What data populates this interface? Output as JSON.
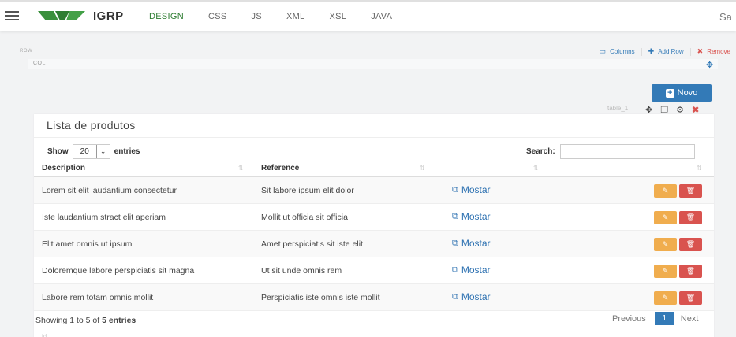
{
  "header": {
    "brand": "IGRP",
    "tabs": [
      "DESIGN",
      "CSS",
      "JS",
      "XML",
      "XSL",
      "JAVA"
    ],
    "active_tab": "DESIGN",
    "save_label": "Sa"
  },
  "rowbar": {
    "row_label": "ROW",
    "col_label": "COL",
    "columns_label": "Columns",
    "add_row_label": "Add Row",
    "remove_label": "Remove"
  },
  "toolbar": {
    "novo_label": "Novo",
    "table_tag": "table_1"
  },
  "panel": {
    "title": "Lista de produtos",
    "show_label": "Show",
    "entries_value": "20",
    "entries_label": "entries",
    "search_label": "Search:",
    "search_value": "",
    "columns": [
      "Description",
      "Reference",
      "",
      ""
    ],
    "rows": [
      {
        "description": "Lorem sit elit laudantium consectetur",
        "reference": "Sit labore ipsum elit dolor",
        "link": "Mostar"
      },
      {
        "description": "Iste laudantium stract elit aperiam",
        "reference": "Mollit ut officia sit officia",
        "link": "Mostar"
      },
      {
        "description": "Elit amet omnis ut ipsum",
        "reference": "Amet perspiciatis sit iste elit",
        "link": "Mostar"
      },
      {
        "description": "Doloremque labore perspiciatis sit magna",
        "reference": "Ut sit unde omnis rem",
        "link": "Mostar"
      },
      {
        "description": "Labore rem totam omnis mollit",
        "reference": "Perspiciatis iste omnis iste mollit",
        "link": "Mostar"
      }
    ],
    "info_prefix": "Showing 1 to 5 of ",
    "info_total": "5 entries",
    "pager": {
      "previous": "Previous",
      "current": "1",
      "next": "Next"
    },
    "footer_tag": "id"
  },
  "colors": {
    "primary": "#337ab7",
    "active_tab": "#2e7d32",
    "edit": "#f0ad4e",
    "delete": "#d9534f"
  }
}
